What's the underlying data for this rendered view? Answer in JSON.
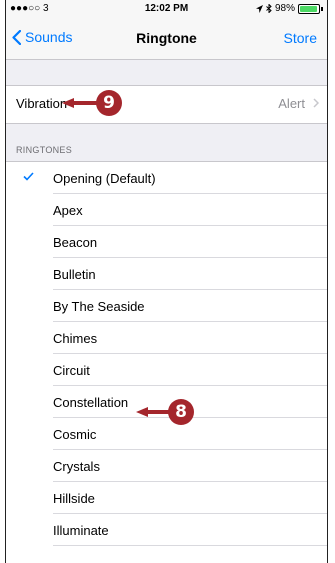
{
  "status_bar": {
    "signal": "●●●○○ 3",
    "time": "12:02 PM",
    "battery": "98%",
    "battery_level": 0.98
  },
  "nav": {
    "back_label": "Sounds",
    "title": "Ringtone",
    "store_label": "Store"
  },
  "vibration": {
    "label": "Vibration",
    "value": "Alert"
  },
  "ringtones": {
    "header": "RINGTONES",
    "items": [
      {
        "label": "Opening (Default)",
        "selected": true
      },
      {
        "label": "Apex"
      },
      {
        "label": "Beacon"
      },
      {
        "label": "Bulletin"
      },
      {
        "label": "By The Seaside"
      },
      {
        "label": "Chimes"
      },
      {
        "label": "Circuit"
      },
      {
        "label": "Constellation"
      },
      {
        "label": "Cosmic"
      },
      {
        "label": "Crystals"
      },
      {
        "label": "Hillside"
      },
      {
        "label": "Illuminate"
      }
    ]
  },
  "callouts": {
    "vibration": "9",
    "constellation": "8",
    "color": "#a4262c"
  },
  "colors": {
    "accent": "#007aff",
    "battery": "#4cd964"
  }
}
